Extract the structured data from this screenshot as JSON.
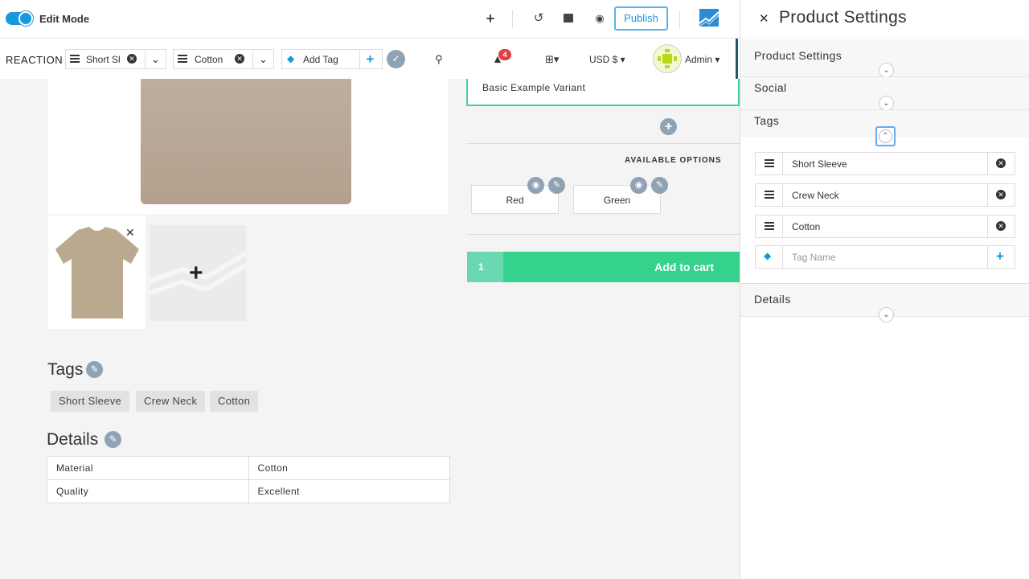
{
  "toolbar": {
    "edit_mode_label": "Edit Mode",
    "publish_label": "Publish"
  },
  "nav": {
    "brand": "REACTION",
    "tag_chips": [
      {
        "label": "Short Sl"
      },
      {
        "label": "Cotton"
      }
    ],
    "add_tag_placeholder": "Add Tag",
    "notification_count": "4",
    "currency": "USD $",
    "user": "Admin"
  },
  "product": {
    "variant_label": "Basic Example Variant",
    "available_options_label": "AVAILABLE OPTIONS",
    "options": [
      "Red",
      "Green"
    ],
    "cart_qty": "1",
    "add_to_cart_label": "Add to cart",
    "tags_heading": "Tags",
    "tags": [
      "Short Sleeve",
      "Crew Neck",
      "Cotton"
    ],
    "details_heading": "Details",
    "details": [
      {
        "key": "Material",
        "value": "Cotton"
      },
      {
        "key": "Quality",
        "value": "Excellent"
      }
    ]
  },
  "panel": {
    "title": "Product Settings",
    "sections": {
      "product_settings": "Product Settings",
      "social": "Social",
      "tags": "Tags",
      "details": "Details"
    },
    "tag_rows": [
      "Short Sleeve",
      "Crew Neck",
      "Cotton"
    ],
    "tag_name_placeholder": "Tag Name"
  },
  "colors": {
    "accent": "#1999dd",
    "cart_green": "#35d28d",
    "variant_border": "#43cfa0",
    "badge_red": "#e0403e"
  }
}
